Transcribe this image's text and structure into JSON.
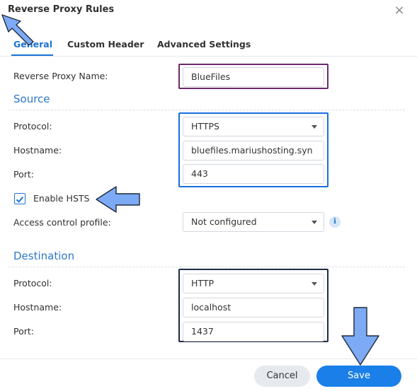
{
  "dialog": {
    "title": "Reverse Proxy Rules",
    "close_glyph": "×"
  },
  "tabs": [
    {
      "label": "General",
      "active": true
    },
    {
      "label": "Custom Header",
      "active": false
    },
    {
      "label": "Advanced Settings",
      "active": false
    }
  ],
  "general": {
    "name_label": "Reverse Proxy Name:",
    "name_value": "BlueFiles"
  },
  "source": {
    "heading": "Source",
    "protocol_label": "Protocol:",
    "protocol_value": "HTTPS",
    "hostname_label": "Hostname:",
    "hostname_value": "bluefiles.mariushosting.syn",
    "port_label": "Port:",
    "port_value": "443",
    "hsts_label": "Enable HSTS",
    "hsts_checked": true,
    "access_label": "Access control profile:",
    "access_value": "Not configured",
    "info_glyph": "i"
  },
  "destination": {
    "heading": "Destination",
    "protocol_label": "Protocol:",
    "protocol_value": "HTTP",
    "hostname_label": "Hostname:",
    "hostname_value": "localhost",
    "port_label": "Port:",
    "port_value": "1437"
  },
  "footer": {
    "cancel_label": "Cancel",
    "save_label": "Save"
  },
  "colors": {
    "accent": "#1a73d1",
    "save_button": "#1a7fe8",
    "highlight_name": "#6b2a6e",
    "highlight_source": "#1a6fe0",
    "highlight_destination": "#1e2b44",
    "annotation_arrow": "#7daaf5"
  }
}
